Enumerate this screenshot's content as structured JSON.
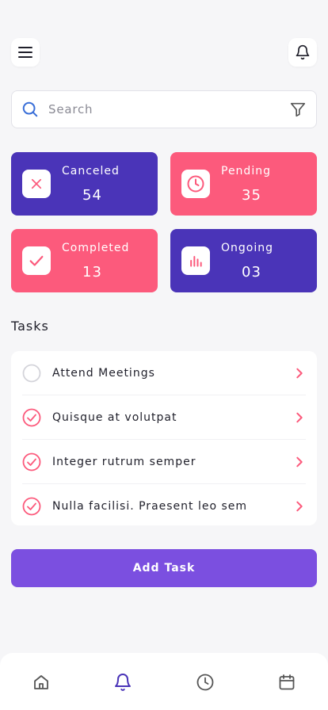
{
  "search": {
    "placeholder": "Search"
  },
  "cards": [
    {
      "label": "Canceled",
      "count": "54",
      "icon": "close-icon",
      "color": "#4a34b8"
    },
    {
      "label": "Pending",
      "count": "35",
      "icon": "clock-icon",
      "color": "#fc5a7c"
    },
    {
      "label": "Completed",
      "count": "13",
      "icon": "check-icon",
      "color": "#fc5a7c"
    },
    {
      "label": "Ongoing",
      "count": "03",
      "icon": "bar-chart-icon",
      "color": "#4a34b8"
    }
  ],
  "tasks": {
    "title": "Tasks",
    "items": [
      {
        "label": "Attend Meetings",
        "done": false
      },
      {
        "label": "Quisque at volutpat",
        "done": true
      },
      {
        "label": "Integer rutrum semper",
        "done": true
      },
      {
        "label": "Nulla facilisi. Praesent leo sem",
        "done": true
      }
    ]
  },
  "add_task_label": "Add Task",
  "nav": {
    "items": [
      "home-icon",
      "bell-icon",
      "clock-icon",
      "calendar-icon"
    ],
    "active": "bell-icon",
    "active_color": "#4a34b8"
  },
  "colors": {
    "primary_purple": "#4a34b8",
    "accent_pink": "#fc5a7c",
    "button_purple": "#7b4fe0"
  }
}
